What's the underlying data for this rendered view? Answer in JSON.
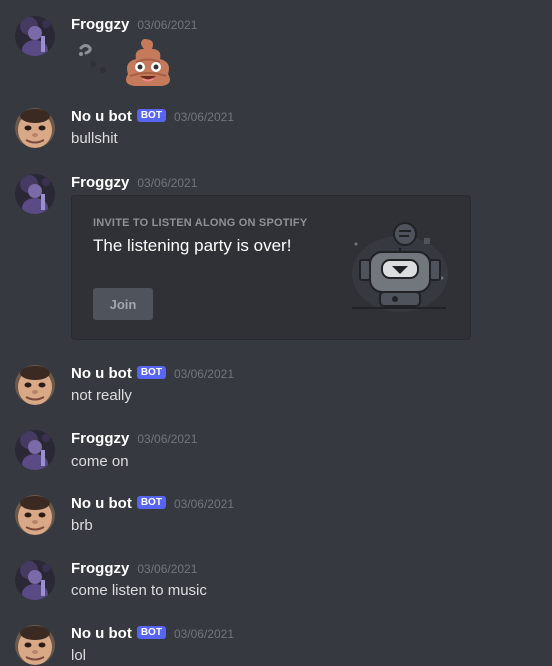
{
  "messages": [
    {
      "author": "Froggzy",
      "bot": false,
      "timestamp": "03/06/2021",
      "content": "",
      "emoji": "pile-of-poo-emoji"
    },
    {
      "author": "No u bot",
      "bot": true,
      "bot_tag": "BOT",
      "timestamp": "03/06/2021",
      "content": "bullshit"
    },
    {
      "author": "Froggzy",
      "bot": false,
      "timestamp": "03/06/2021",
      "content": "",
      "invite": {
        "header": "INVITE TO LISTEN ALONG ON SPOTIFY",
        "title": "The listening party is over!",
        "button": "Join",
        "art_icon": "spotify-listening-robot-illustration"
      }
    },
    {
      "author": "No u bot",
      "bot": true,
      "bot_tag": "BOT",
      "timestamp": "03/06/2021",
      "content": "not really"
    },
    {
      "author": "Froggzy",
      "bot": false,
      "timestamp": "03/06/2021",
      "content": "come on"
    },
    {
      "author": "No u bot",
      "bot": true,
      "bot_tag": "BOT",
      "timestamp": "03/06/2021",
      "content": "brb"
    },
    {
      "author": "Froggzy",
      "bot": false,
      "timestamp": "03/06/2021",
      "content": "come listen to music"
    },
    {
      "author": "No u bot",
      "bot": true,
      "bot_tag": "BOT",
      "timestamp": "03/06/2021",
      "content": "lol"
    }
  ],
  "colors": {
    "background": "#36393f",
    "embed_background": "#2f3136",
    "bot_tag": "#5865f2",
    "timestamp": "#72767d",
    "text": "#dcddde"
  }
}
